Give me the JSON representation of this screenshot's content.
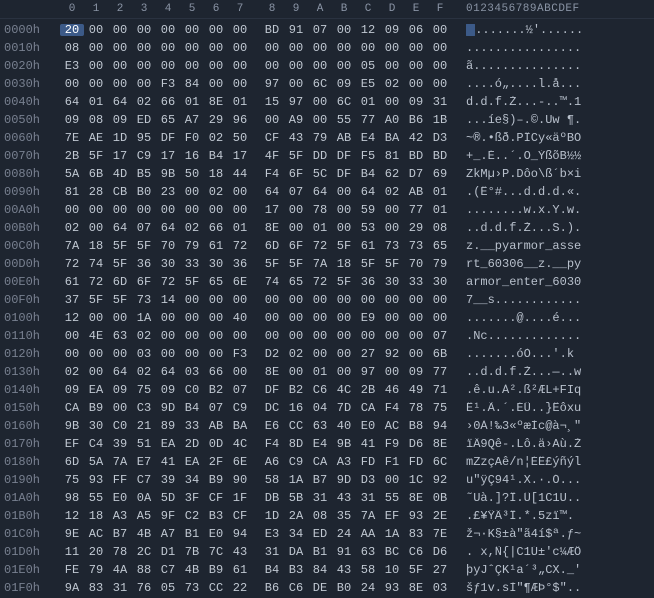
{
  "header": {
    "cols": [
      "0",
      "1",
      "2",
      "3",
      "4",
      "5",
      "6",
      "7",
      "8",
      "9",
      "A",
      "B",
      "C",
      "D",
      "E",
      "F"
    ],
    "ascii_header": "0123456789ABCDEF"
  },
  "selection": {
    "row": 0,
    "col": 0
  },
  "rows": [
    {
      "addr": "0000h",
      "bytes": [
        "20",
        "00",
        "00",
        "00",
        "00",
        "00",
        "00",
        "00",
        "BD",
        "91",
        "07",
        "00",
        "12",
        "09",
        "06",
        "00"
      ],
      "ascii": " .......½'......"
    },
    {
      "addr": "0010h",
      "bytes": [
        "08",
        "00",
        "00",
        "00",
        "00",
        "00",
        "00",
        "00",
        "00",
        "00",
        "00",
        "00",
        "00",
        "00",
        "00",
        "00"
      ],
      "ascii": "................"
    },
    {
      "addr": "0020h",
      "bytes": [
        "E3",
        "00",
        "00",
        "00",
        "00",
        "00",
        "00",
        "00",
        "00",
        "00",
        "00",
        "00",
        "05",
        "00",
        "00",
        "00"
      ],
      "ascii": "ã..............."
    },
    {
      "addr": "0030h",
      "bytes": [
        "00",
        "00",
        "00",
        "00",
        "F3",
        "84",
        "00",
        "00",
        "97",
        "00",
        "6C",
        "09",
        "E5",
        "02",
        "00",
        "00"
      ],
      "ascii": "....ó„....l.å..."
    },
    {
      "addr": "0040h",
      "bytes": [
        "64",
        "01",
        "64",
        "02",
        "66",
        "01",
        "8E",
        "01",
        "15",
        "97",
        "00",
        "6C",
        "01",
        "00",
        "09",
        "31"
      ],
      "ascii": "d.d.f.Ž...-..™.1"
    },
    {
      "addr": "0050h",
      "bytes": [
        "09",
        "08",
        "09",
        "ED",
        "65",
        "A7",
        "29",
        "96",
        "00",
        "A9",
        "00",
        "55",
        "77",
        "A0",
        "B6",
        "1B"
      ],
      "ascii": "...íe§)–.©.Uw ¶."
    },
    {
      "addr": "0060h",
      "bytes": [
        "7E",
        "AE",
        "1D",
        "95",
        "DF",
        "F0",
        "02",
        "50",
        "CF",
        "43",
        "79",
        "AB",
        "E4",
        "BA",
        "42",
        "D3"
      ],
      "ascii": "~®.•ßð.PÏCy«äºBÓ"
    },
    {
      "addr": "0070h",
      "bytes": [
        "2B",
        "5F",
        "17",
        "C9",
        "17",
        "16",
        "B4",
        "17",
        "4F",
        "5F",
        "DD",
        "DF",
        "F5",
        "81",
        "BD",
        "BD"
      ],
      "ascii": "+_.É..´.O_ÝßõB½½"
    },
    {
      "addr": "0080h",
      "bytes": [
        "5A",
        "6B",
        "4D",
        "B5",
        "9B",
        "50",
        "18",
        "44",
        "F4",
        "6F",
        "5C",
        "DF",
        "B4",
        "62",
        "D7",
        "69"
      ],
      "ascii": "ZkMµ›P.Dôo\\ß´b×i"
    },
    {
      "addr": "0090h",
      "bytes": [
        "81",
        "28",
        "CB",
        "B0",
        "23",
        "00",
        "02",
        "00",
        "64",
        "07",
        "64",
        "00",
        "64",
        "02",
        "AB",
        "01"
      ],
      "ascii": ".(Ë°#...d.d.d.«."
    },
    {
      "addr": "00A0h",
      "bytes": [
        "00",
        "00",
        "00",
        "00",
        "00",
        "00",
        "00",
        "00",
        "17",
        "00",
        "78",
        "00",
        "59",
        "00",
        "77",
        "01"
      ],
      "ascii": "........w.x.Y.w."
    },
    {
      "addr": "00B0h",
      "bytes": [
        "02",
        "00",
        "64",
        "07",
        "64",
        "02",
        "66",
        "01",
        "8E",
        "00",
        "01",
        "00",
        "53",
        "00",
        "29",
        "08"
      ],
      "ascii": "..d.d.f.Ž...S.)."
    },
    {
      "addr": "00C0h",
      "bytes": [
        "7A",
        "18",
        "5F",
        "5F",
        "70",
        "79",
        "61",
        "72",
        "6D",
        "6F",
        "72",
        "5F",
        "61",
        "73",
        "73",
        "65"
      ],
      "ascii": "z.__pyarmor_asse"
    },
    {
      "addr": "00D0h",
      "bytes": [
        "72",
        "74",
        "5F",
        "36",
        "30",
        "33",
        "30",
        "36",
        "5F",
        "5F",
        "7A",
        "18",
        "5F",
        "5F",
        "70",
        "79"
      ],
      "ascii": "rt_60306__z.__py"
    },
    {
      "addr": "00E0h",
      "bytes": [
        "61",
        "72",
        "6D",
        "6F",
        "72",
        "5F",
        "65",
        "6E",
        "74",
        "65",
        "72",
        "5F",
        "36",
        "30",
        "33",
        "30"
      ],
      "ascii": "armor_enter_6030"
    },
    {
      "addr": "00F0h",
      "bytes": [
        "37",
        "5F",
        "5F",
        "73",
        "14",
        "00",
        "00",
        "00",
        "00",
        "00",
        "00",
        "00",
        "00",
        "00",
        "00",
        "00"
      ],
      "ascii": "7__s............"
    },
    {
      "addr": "0100h",
      "bytes": [
        "12",
        "00",
        "00",
        "1A",
        "00",
        "00",
        "00",
        "40",
        "00",
        "00",
        "00",
        "00",
        "E9",
        "00",
        "00",
        "00"
      ],
      "ascii": ".......@....é..."
    },
    {
      "addr": "0110h",
      "bytes": [
        "00",
        "4E",
        "63",
        "02",
        "00",
        "00",
        "00",
        "00",
        "00",
        "00",
        "00",
        "00",
        "00",
        "00",
        "00",
        "07"
      ],
      "ascii": ".Nc............."
    },
    {
      "addr": "0120h",
      "bytes": [
        "00",
        "00",
        "00",
        "03",
        "00",
        "00",
        "00",
        "F3",
        "D2",
        "02",
        "00",
        "00",
        "27",
        "92",
        "00",
        "6B"
      ],
      "ascii": ".......óÒ...'.k"
    },
    {
      "addr": "0130h",
      "bytes": [
        "02",
        "00",
        "64",
        "02",
        "64",
        "03",
        "66",
        "00",
        "8E",
        "00",
        "01",
        "00",
        "97",
        "00",
        "09",
        "77"
      ],
      "ascii": "..d.d.f.Ž...—..w"
    },
    {
      "addr": "0140h",
      "bytes": [
        "09",
        "EA",
        "09",
        "75",
        "09",
        "C0",
        "B2",
        "07",
        "DF",
        "B2",
        "C6",
        "4C",
        "2B",
        "46",
        "49",
        "71"
      ],
      "ascii": ".ê.u.À².ß²ÆL+FIq"
    },
    {
      "addr": "0150h",
      "bytes": [
        "CA",
        "B9",
        "00",
        "C3",
        "9D",
        "B4",
        "07",
        "C9",
        "DC",
        "16",
        "04",
        "7D",
        "CA",
        "F4",
        "78",
        "75"
      ],
      "ascii": "Ê¹.Ã.´.ÉÜ..}Êôxu"
    },
    {
      "addr": "0160h",
      "bytes": [
        "9B",
        "30",
        "C0",
        "21",
        "89",
        "33",
        "AB",
        "BA",
        "E6",
        "CC",
        "63",
        "40",
        "E0",
        "AC",
        "B8",
        "94"
      ],
      "ascii": "›0À!‰3«ºæÌc@à¬¸\""
    },
    {
      "addr": "0170h",
      "bytes": [
        "EF",
        "C4",
        "39",
        "51",
        "EA",
        "2D",
        "0D",
        "4C",
        "F4",
        "8D",
        "E4",
        "9B",
        "41",
        "F9",
        "D6",
        "8E"
      ],
      "ascii": "ïÄ9Qê-.Lô.ä›Aù.Ž"
    },
    {
      "addr": "0180h",
      "bytes": [
        "6D",
        "5A",
        "7A",
        "E7",
        "41",
        "EA",
        "2F",
        "6E",
        "A6",
        "C9",
        "CA",
        "A3",
        "FD",
        "F1",
        "FD",
        "6C"
      ],
      "ascii": "mZzçAê/n¦ÉÊ£ýñýl"
    },
    {
      "addr": "0190h",
      "bytes": [
        "75",
        "93",
        "FF",
        "C7",
        "39",
        "34",
        "B9",
        "90",
        "58",
        "1A",
        "B7",
        "9D",
        "D3",
        "00",
        "1C",
        "92"
      ],
      "ascii": "u\"ÿÇ94¹.X.·.Ó..."
    },
    {
      "addr": "01A0h",
      "bytes": [
        "98",
        "55",
        "E0",
        "0A",
        "5D",
        "3F",
        "CF",
        "1F",
        "DB",
        "5B",
        "31",
        "43",
        "31",
        "55",
        "8E",
        "0B"
      ],
      "ascii": "˜Uà.]?Ï.Û[1C1U.."
    },
    {
      "addr": "01B0h",
      "bytes": [
        "12",
        "18",
        "A3",
        "A5",
        "9F",
        "C2",
        "B3",
        "CF",
        "1D",
        "2A",
        "08",
        "35",
        "7A",
        "EF",
        "93",
        "2E"
      ],
      "ascii": ".£¥ŸÂ³Ï.*.5zï™."
    },
    {
      "addr": "01C0h",
      "bytes": [
        "9E",
        "AC",
        "B7",
        "4B",
        "A7",
        "B1",
        "E0",
        "94",
        "E3",
        "34",
        "ED",
        "24",
        "AA",
        "1A",
        "83",
        "7E"
      ],
      "ascii": "ž¬·K§±à\"ã4í$ª.ƒ~"
    },
    {
      "addr": "01D0h",
      "bytes": [
        "11",
        "20",
        "78",
        "2C",
        "D1",
        "7B",
        "7C",
        "43",
        "31",
        "DA",
        "B1",
        "91",
        "63",
        "BC",
        "C6",
        "D6"
      ],
      "ascii": ". x,Ñ{|C1Ú±'c¼ÆÖ"
    },
    {
      "addr": "01E0h",
      "bytes": [
        "FE",
        "79",
        "4A",
        "88",
        "C7",
        "4B",
        "B9",
        "61",
        "B4",
        "B3",
        "84",
        "43",
        "58",
        "10",
        "5F",
        "27"
      ],
      "ascii": "þyJˆÇK¹a´³„CX._'"
    },
    {
      "addr": "01F0h",
      "bytes": [
        "9A",
        "83",
        "31",
        "76",
        "05",
        "73",
        "CC",
        "22",
        "B6",
        "C6",
        "DE",
        "B0",
        "24",
        "93",
        "8E",
        "03"
      ],
      "ascii": "šƒ1v.sÌ\"¶ÆÞ°$\".."
    }
  ]
}
